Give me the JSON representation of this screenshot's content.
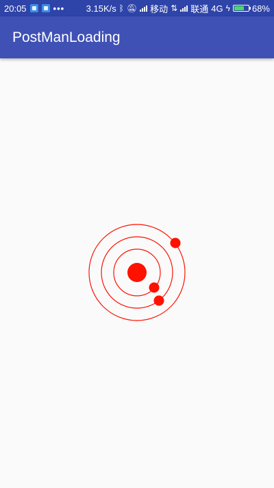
{
  "status_bar": {
    "time": "20:05",
    "network_speed": "3.15K/s",
    "carrier_1": "移动",
    "carrier_2": "联通",
    "network_type": "4G",
    "battery": "68%",
    "battery_level": 0.68,
    "background_color": "#2f44a8",
    "icons": [
      "usb-icon",
      "notification-icon",
      "bluetooth-icon",
      "alarm-muted-icon",
      "signal-icon",
      "data-activity-icon",
      "charging-icon",
      "battery-icon"
    ]
  },
  "app_bar": {
    "title": "PostManLoading",
    "background_color": "#3f51b5"
  },
  "loader": {
    "color": "#ff1100",
    "rings": 3,
    "moving_dots": 3
  }
}
